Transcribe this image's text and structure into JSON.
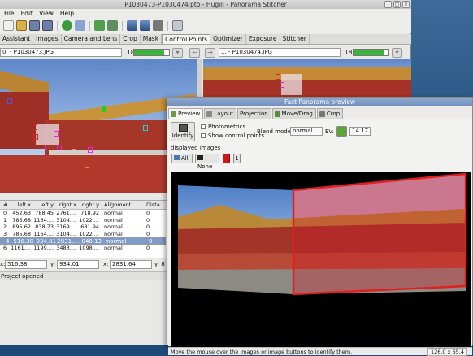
{
  "main_window": {
    "title": "P1030473-P1030474.pto - Hugin - Panorama Stitcher",
    "menu": [
      "File",
      "Edit",
      "View",
      "Help"
    ],
    "tabs": [
      "Assistant",
      "Images",
      "Camera and Lens",
      "Crop",
      "Mask",
      "Control Points",
      "Optimizer",
      "Exposure",
      "Stitcher"
    ],
    "active_tab": "Control Points",
    "left_image": {
      "value": "0. - P1030473.JPG",
      "count": "18",
      "quality": 0.85
    },
    "right_image": {
      "value": "1. - P1030474.JPG",
      "count": "18",
      "quality": 0.85
    },
    "table": {
      "headers": [
        "#",
        "left x",
        "left y",
        "right x",
        "right y",
        "Alignment",
        "Dista"
      ],
      "rows": [
        [
          "0",
          "452.63",
          "788.45",
          "2761....",
          "718.92",
          "normal",
          "0"
        ],
        [
          "1",
          "785.68",
          "1164....",
          "3104....",
          "1022....",
          "normal",
          "0"
        ],
        [
          "2",
          "895.62",
          "838.73",
          "3169....",
          "681.94",
          "normal",
          "0"
        ],
        [
          "3",
          "785.68",
          "1164....",
          "3104....",
          "1022....",
          "normal",
          "0"
        ],
        [
          "4",
          "516.38",
          "934.01",
          "2831....",
          "840.13",
          "normal",
          "0"
        ],
        [
          "5",
          "1136....",
          "944.38",
          "3445....",
          "742.19",
          "normal",
          "0"
        ],
        [
          "6",
          "1161....",
          "1199....",
          "3483....",
          "1098....",
          "normal",
          "0"
        ]
      ],
      "selected_row": 4
    },
    "coords": {
      "x_label": "x:",
      "x_value": "516.38",
      "y_label": "y:",
      "y_value": "934.01",
      "x2_label": "x:",
      "x2_value": "2831.64",
      "y2_label": "y: 8"
    },
    "status": "Project opened"
  },
  "preview_window": {
    "title": "Fast Panorama preview",
    "tabs": [
      "Preview",
      "Layout",
      "Projection",
      "Move/Drag",
      "Crop"
    ],
    "active_tab": "Preview",
    "identify_label": "Identify",
    "photometrics_label": "Photometrics",
    "show_cp_label": "Show control points",
    "blend_mode_label": "Blend mode:",
    "blend_mode_value": "normal",
    "ev_label": "EV:",
    "ev_value": "14.17",
    "displayed_images_label": "displayed images",
    "all_label": "All",
    "none_label": "None",
    "image_buttons": [
      "0",
      "1"
    ],
    "status": "Move the mouse over the images or image buttons to identify them.",
    "fov": "126.0 x 65.4"
  },
  "colors": {
    "accent_green": "#3cb43c",
    "selection": "#7f9cc9",
    "highlight_red": "#d01818",
    "preview_title": "#7f9cc9"
  }
}
